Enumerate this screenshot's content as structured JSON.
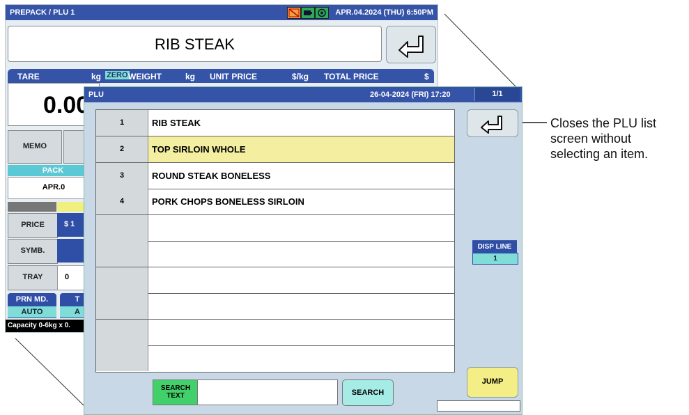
{
  "background_screen": {
    "title": "PREPACK / PLU 1",
    "datetime": "APR.04.2024 (THU)  6:50PM",
    "item_name": "RIB STEAK",
    "weigh_header": {
      "tare": "TARE",
      "tare_unit": "kg",
      "zero": "ZERO",
      "weight": "WEIGHT",
      "weight_unit": "kg",
      "unit_price": "UNIT PRICE",
      "unit_price_unit": "$/kg",
      "total_price": "TOTAL PRICE",
      "total_price_unit": "$"
    },
    "tare_value": "0.00",
    "memo_label": "MEMO",
    "pack_label": "PACK",
    "pack_date": "APR.0",
    "rows": [
      {
        "label": "PRICE",
        "value": "$ 1"
      },
      {
        "label": "SYMB.",
        "value": ""
      },
      {
        "label": "TRAY",
        "value": "0"
      }
    ],
    "prn_md_label": "PRN MD.",
    "prn_md_value": "AUTO",
    "t_label": "T",
    "t_value": "A",
    "capacity": "Capacity 0-6kg x 0."
  },
  "plu_screen": {
    "title": "PLU",
    "datetime": "26-04-2024 (FRI) 17:20",
    "page": "1/1",
    "items": [
      {
        "num": "1",
        "name": "RIB STEAK"
      },
      {
        "num": "2",
        "name": "TOP SIRLOIN WHOLE"
      },
      {
        "num": "3",
        "name": "ROUND STEAK BONELESS"
      },
      {
        "num": "4",
        "name": "PORK CHOPS BONELESS SIRLOIN"
      },
      {
        "num": "",
        "name": ""
      },
      {
        "num": "",
        "name": ""
      },
      {
        "num": "",
        "name": ""
      },
      {
        "num": "",
        "name": ""
      },
      {
        "num": "",
        "name": ""
      },
      {
        "num": "",
        "name": ""
      }
    ],
    "selected_index": 1,
    "disp_line_label": "DISP LINE",
    "disp_line_value": "1",
    "jump_label": "JUMP",
    "search_text_label_1": "SEARCH",
    "search_text_label_2": "TEXT",
    "search_input_value": "",
    "search_button": "SEARCH"
  },
  "annotation": {
    "line1": "Closes the PLU list",
    "line2": "screen without",
    "line3": "selecting an item."
  }
}
